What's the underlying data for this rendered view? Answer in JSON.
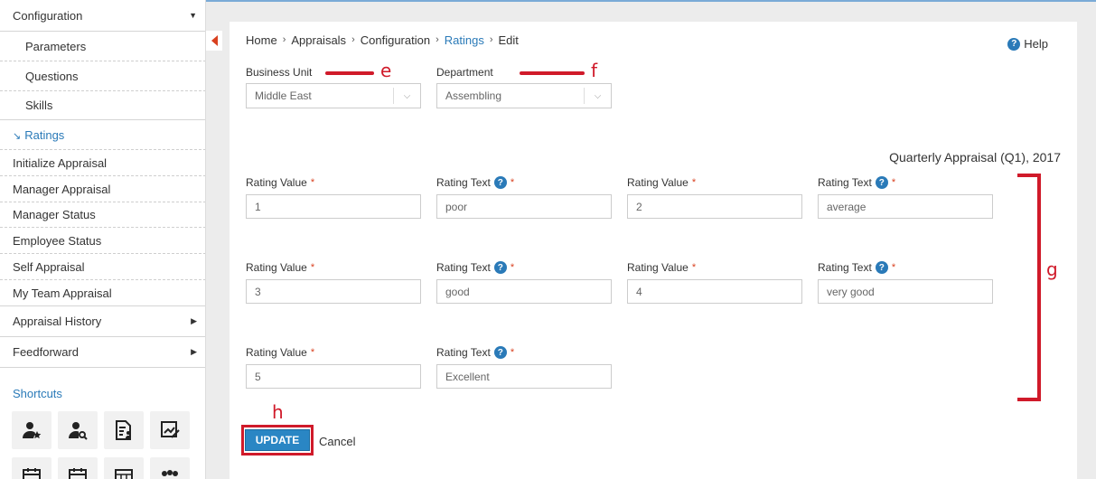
{
  "sidebar": {
    "items": [
      {
        "label": "Configuration",
        "arrow": "▼",
        "type": "top"
      },
      {
        "label": "Parameters",
        "type": "sub"
      },
      {
        "label": "Questions",
        "type": "sub"
      },
      {
        "label": "Skills",
        "type": "sub"
      },
      {
        "label": "Ratings",
        "type": "active"
      },
      {
        "label": "Initialize Appraisal",
        "type": "item"
      },
      {
        "label": "Manager Appraisal",
        "type": "item"
      },
      {
        "label": "Manager Status",
        "type": "item"
      },
      {
        "label": "Employee Status",
        "type": "item"
      },
      {
        "label": "Self Appraisal",
        "type": "item"
      },
      {
        "label": "My Team Appraisal",
        "type": "item"
      },
      {
        "label": "Appraisal History",
        "arrow": "▶",
        "type": "top"
      },
      {
        "label": "Feedforward",
        "arrow": "▶",
        "type": "top"
      }
    ],
    "active_marker": "↘",
    "shortcuts_title": "Shortcuts",
    "shortcut_icons": [
      "user-star-icon",
      "user-search-icon",
      "document-user-icon",
      "edit-chart-icon",
      "calendar-icon",
      "calendar-icon",
      "grid-calendar-icon",
      "group-icon"
    ]
  },
  "breadcrumb": [
    {
      "label": "Home",
      "link": false
    },
    {
      "label": "Appraisals",
      "link": false
    },
    {
      "label": "Configuration",
      "link": false
    },
    {
      "label": "Ratings",
      "link": true
    },
    {
      "label": "Edit",
      "link": false
    }
  ],
  "breadcrumb_sep": "›",
  "help_label": "Help",
  "business_unit": {
    "label": "Business Unit",
    "value": "Middle East"
  },
  "department": {
    "label": "Department",
    "value": "Assembling"
  },
  "period_title": "Quarterly Appraisal (Q1), 2017",
  "ratings": [
    {
      "value_label": "Rating Value",
      "value": "1",
      "text_label": "Rating Text",
      "text": "poor"
    },
    {
      "value_label": "Rating Value",
      "value": "2",
      "text_label": "Rating Text",
      "text": "average"
    },
    {
      "value_label": "Rating Value",
      "value": "3",
      "text_label": "Rating Text",
      "text": "good"
    },
    {
      "value_label": "Rating Value",
      "value": "4",
      "text_label": "Rating Text",
      "text": "very good"
    },
    {
      "value_label": "Rating Value",
      "value": "5",
      "text_label": "Rating Text",
      "text": "Excellent"
    }
  ],
  "required_mark": "*",
  "help_glyph": "?",
  "annotations": {
    "e": "e",
    "f": "f",
    "g": "g",
    "h": "h"
  },
  "buttons": {
    "update": "UPDATE",
    "cancel": "Cancel"
  },
  "colors": {
    "accent": "#2a7ab8",
    "annotation": "#d01a2a",
    "button": "#2a86c4"
  }
}
